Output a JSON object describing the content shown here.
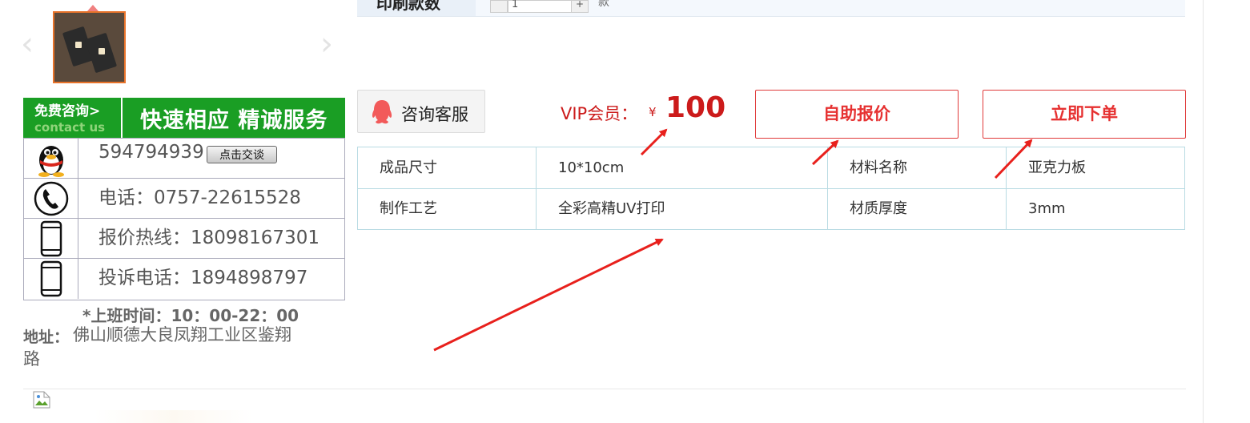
{
  "gallery": {
    "prev_arrow": "‹",
    "next_arrow": "›",
    "thumbnail_icon": "business-card-thumbnail"
  },
  "banner": {
    "free_consult": "免费咨询>",
    "contact_us": "contact us",
    "slogan": "快速相应 精诚服务"
  },
  "contacts": [
    {
      "icon": "qq-penguin-icon",
      "text": "594794939",
      "button": "点击交谈"
    },
    {
      "icon": "phone-handset-icon",
      "text": "电话：0757-22615528"
    },
    {
      "icon": "mobile-phone-icon",
      "text": "报价热线：18098167301"
    },
    {
      "icon": "mobile-phone-icon",
      "text": "投诉电话：1894898797"
    }
  ],
  "hours": "*上班时间：10：00-22：00",
  "address": {
    "label": "地址：",
    "text": "佛山顺德大良凤翔工业区鉴翔",
    "tail": "路"
  },
  "top_row": {
    "label": "印刷款数",
    "quantity": "1",
    "plus": "+",
    "unit": "款"
  },
  "customer_service": {
    "label": "咨询客服",
    "icon": "qq-icon"
  },
  "vip": {
    "label": "VIP会员：",
    "currency": "¥",
    "price": "100"
  },
  "buttons": {
    "self_quote": "自助报价",
    "order_now": "立即下单"
  },
  "specs": [
    {
      "k1": "成品尺寸",
      "v1": "10*10cm",
      "k2": "材料名称",
      "v2": "亚克力板"
    },
    {
      "k1": "制作工艺",
      "v1": "全彩高精UV打印",
      "k2": "材质厚度",
      "v2": "3mm"
    }
  ],
  "colors": {
    "brand_green": "#1a9e24",
    "accent_red": "#e63131",
    "annotation_arrow": "#e8201c",
    "thumb_border": "#e8732a"
  }
}
